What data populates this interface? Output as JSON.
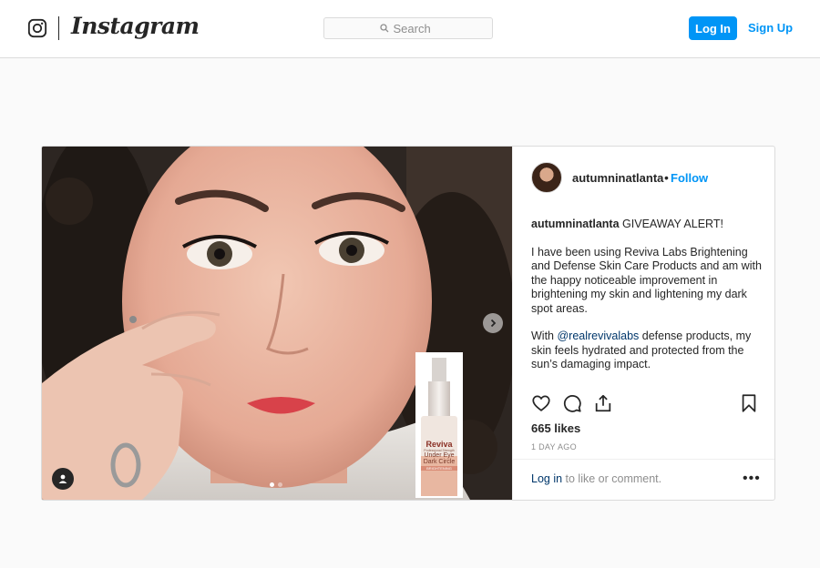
{
  "header": {
    "logo_text": "Instagram",
    "search_placeholder": "Search",
    "login_label": "Log In",
    "signup_label": "Sign Up"
  },
  "post": {
    "username": "autumninatlanta",
    "separator": "•",
    "follow_label": "Follow",
    "caption": {
      "author": "autumninatlanta",
      "headline": "GIVEAWAY ALERT!",
      "paragraph_1": "I have been using Reviva Labs Brightening and Defense Skin Care Products and am with the happy noticeable improvement in brightening my skin and lightening my dark spot areas.",
      "paragraph_2_before": "With ",
      "mention": "@realrevivalabs",
      "paragraph_2_after": " defense products, my skin feels hydrated and protected from the sun’s damaging impact."
    },
    "likes": "665 likes",
    "timestamp": "1 DAY AGO",
    "comment_prompt": {
      "login_link": "Log in",
      "rest": " to like or comment."
    },
    "more_label": "•••",
    "carousel": {
      "total": 2,
      "active_index": 0
    },
    "product": {
      "brand": "Reviva",
      "sub": "LABS",
      "line1": "Professional Strength",
      "line2": "Under Eye",
      "line3": "Dark Circle",
      "line4": "Serum",
      "tag": "BRIGHTENING",
      "volume": "1 FL. OZ. / 30 mL"
    }
  },
  "colors": {
    "accent": "#0095f6",
    "border": "#dbdbdb",
    "text": "#262626",
    "muted": "#8e8e8e",
    "link_dark": "#00376b"
  },
  "icons": {
    "logo": "instagram-glyph-icon",
    "search": "search-icon",
    "like": "heart-icon",
    "comment": "comment-icon",
    "share": "share-icon",
    "save": "bookmark-icon",
    "next": "chevron-right-icon",
    "tag": "user-tag-icon"
  }
}
